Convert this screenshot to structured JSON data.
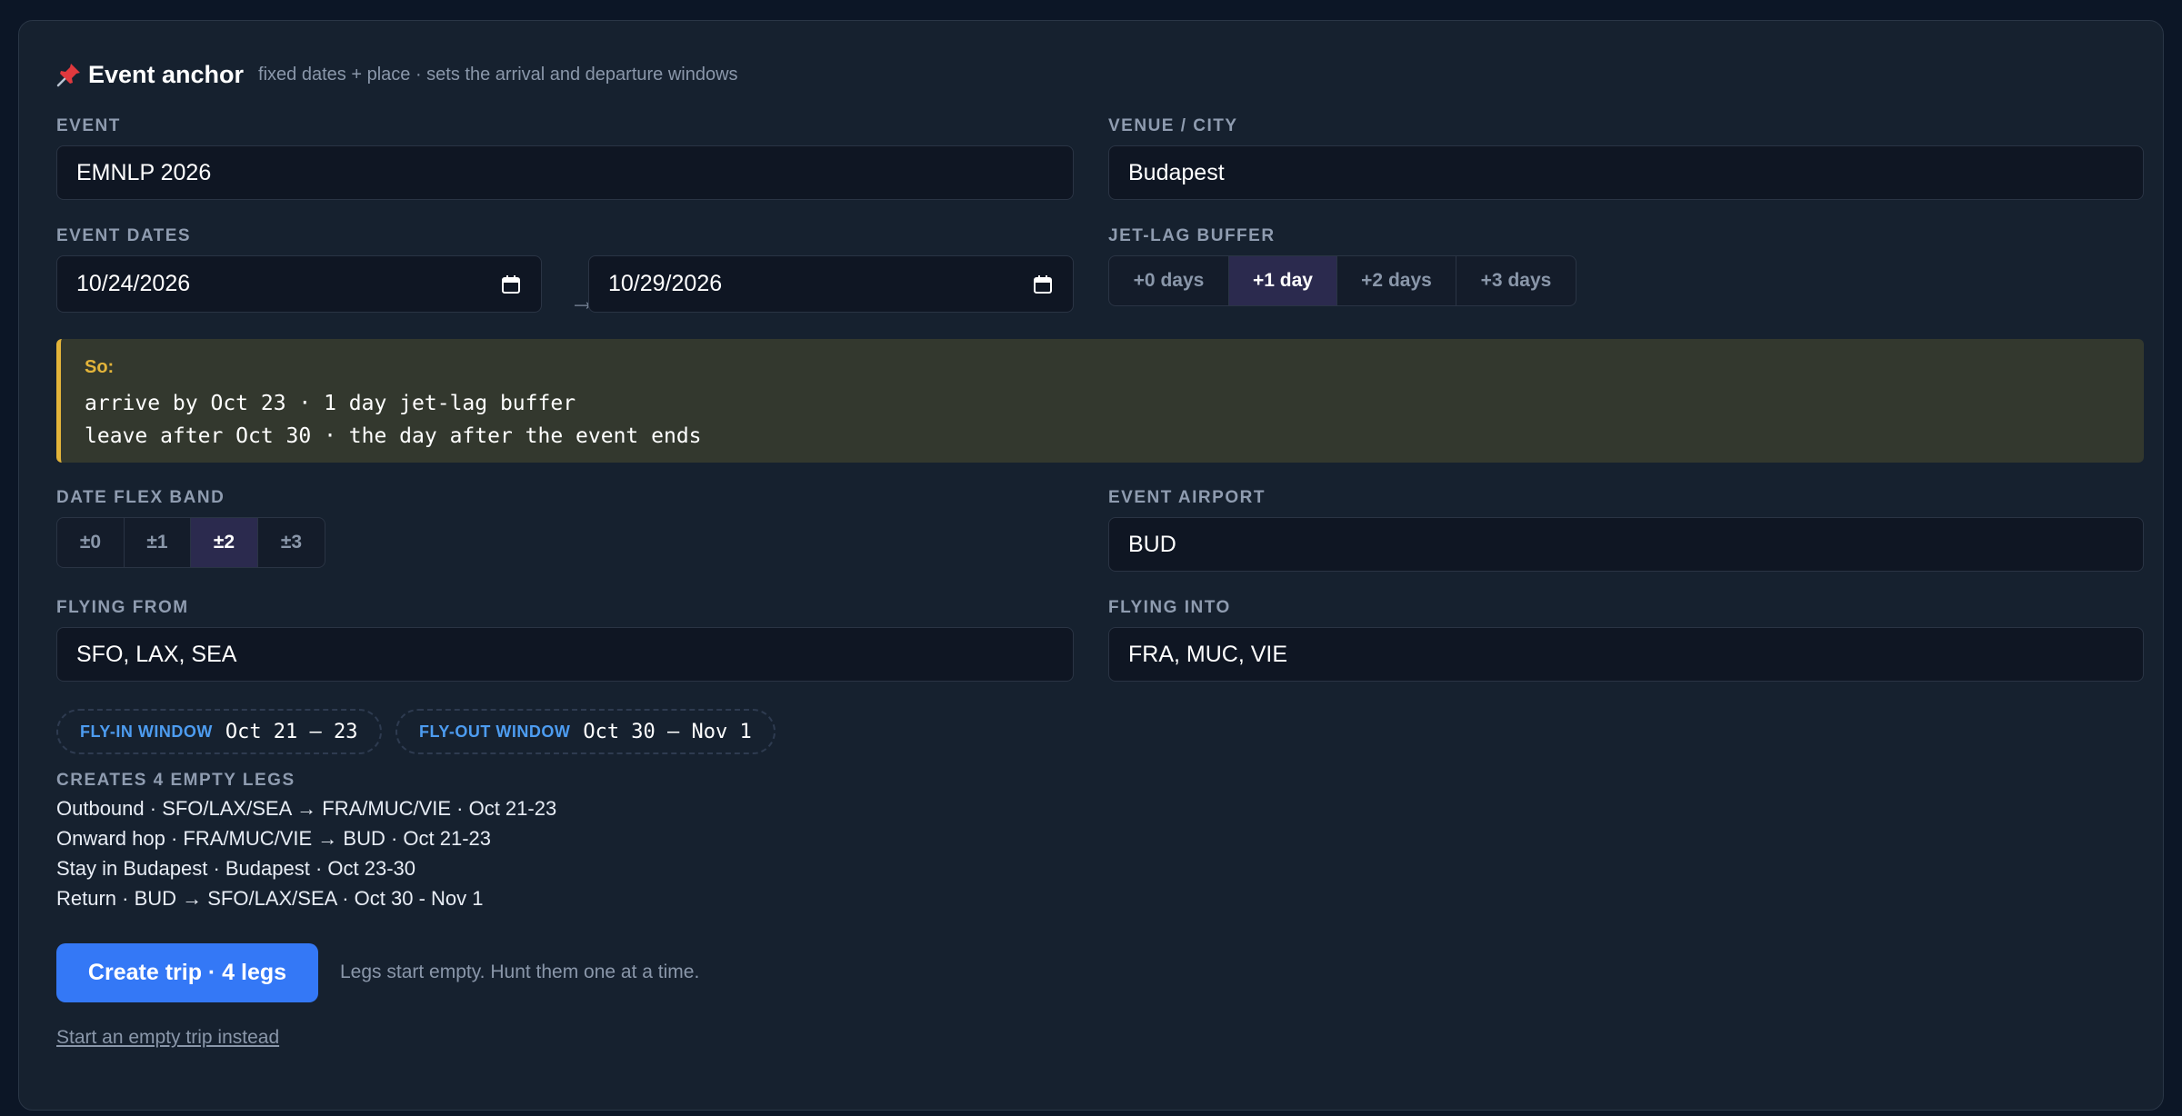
{
  "header": {
    "icon": "pushpin-icon",
    "title": "Event anchor",
    "subtitle": "fixed dates + place · sets the arrival and departure windows"
  },
  "event": {
    "label": "EVENT",
    "value": "EMNLP 2026"
  },
  "venue": {
    "label": "VENUE / CITY",
    "value": "Budapest"
  },
  "event_dates": {
    "label": "EVENT DATES",
    "start": "10/24/2026",
    "arrow": "→",
    "end": "10/29/2026",
    "icon": "calendar-icon"
  },
  "jetlag": {
    "label": "JET-LAG BUFFER",
    "options": [
      "+0 days",
      "+1 day",
      "+2 days",
      "+3 days"
    ],
    "selected": "+1 day"
  },
  "summary": {
    "label": "So:",
    "lines": [
      "arrive by Oct 23 · 1 day jet-lag buffer",
      "leave after Oct 30 · the day after the event ends"
    ],
    "accent": "#e3b43a"
  },
  "flex": {
    "label": "DATE FLEX BAND",
    "options": [
      "±0",
      "±1",
      "±2",
      "±3"
    ],
    "selected": "±2"
  },
  "event_airport": {
    "label": "EVENT AIRPORT",
    "value": "BUD"
  },
  "flying_from": {
    "label": "FLYING FROM",
    "value": "SFO, LAX, SEA"
  },
  "flying_into": {
    "label": "FLYING INTO",
    "value": "FRA, MUC, VIE"
  },
  "windows": {
    "fly_in": {
      "label": "FLY-IN WINDOW",
      "value": "Oct 21 – 23"
    },
    "fly_out": {
      "label": "FLY-OUT WINDOW",
      "value": "Oct 30 – Nov 1"
    }
  },
  "legs": {
    "title": "CREATES 4 EMPTY LEGS",
    "items": [
      "Outbound · SFO/LAX/SEA → FRA/MUC/VIE · Oct 21-23",
      "Onward hop · FRA/MUC/VIE → BUD · Oct 21-23",
      "Stay in Budapest · Budapest · Oct 23-30",
      "Return · BUD → SFO/LAX/SEA · Oct 30 - Nov 1"
    ]
  },
  "actions": {
    "create_label": "Create trip · 4 legs",
    "create_hint": "Legs start empty. Hunt them one at a time.",
    "empty_link": "Start an empty trip instead"
  },
  "colors": {
    "background": "#0c1626",
    "panel": "#16212f",
    "primary": "#3478f6",
    "selected_segment": "#2b2a4e",
    "window_label": "#4d9cf0"
  }
}
